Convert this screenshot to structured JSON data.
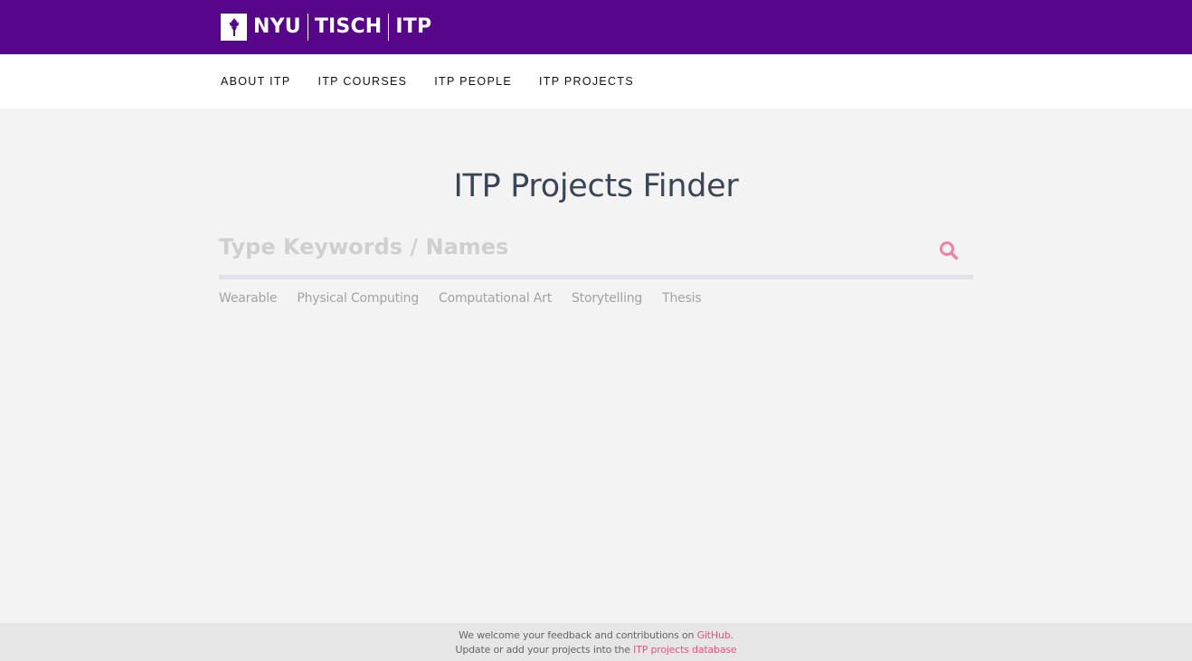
{
  "header": {
    "logo": {
      "parts": [
        "NYU",
        "TISCH",
        "ITP"
      ]
    }
  },
  "nav": {
    "items": [
      {
        "label": "ABOUT ITP"
      },
      {
        "label": "ITP COURSES"
      },
      {
        "label": "ITP PEOPLE"
      },
      {
        "label": "ITP PROJECTS"
      }
    ]
  },
  "main": {
    "title": "ITP Projects Finder",
    "search": {
      "placeholder": "Type Keywords / Names",
      "value": "",
      "icon": "search-icon",
      "icon_color": "#f27fa5"
    },
    "tags": [
      {
        "label": "Wearable"
      },
      {
        "label": "Physical Computing"
      },
      {
        "label": "Computational Art"
      },
      {
        "label": "Storytelling"
      },
      {
        "label": "Thesis"
      }
    ]
  },
  "footer": {
    "line1_prefix": "We welcome your feedback and contributions on ",
    "line1_link": "GitHub",
    "line1_suffix": ".",
    "line2_prefix": "Update or add your projects into the ",
    "line2_link": "ITP projects database"
  },
  "colors": {
    "brand_purple": "#57068c",
    "accent_pink": "#ef4f7f",
    "title_color": "#3a4556"
  }
}
